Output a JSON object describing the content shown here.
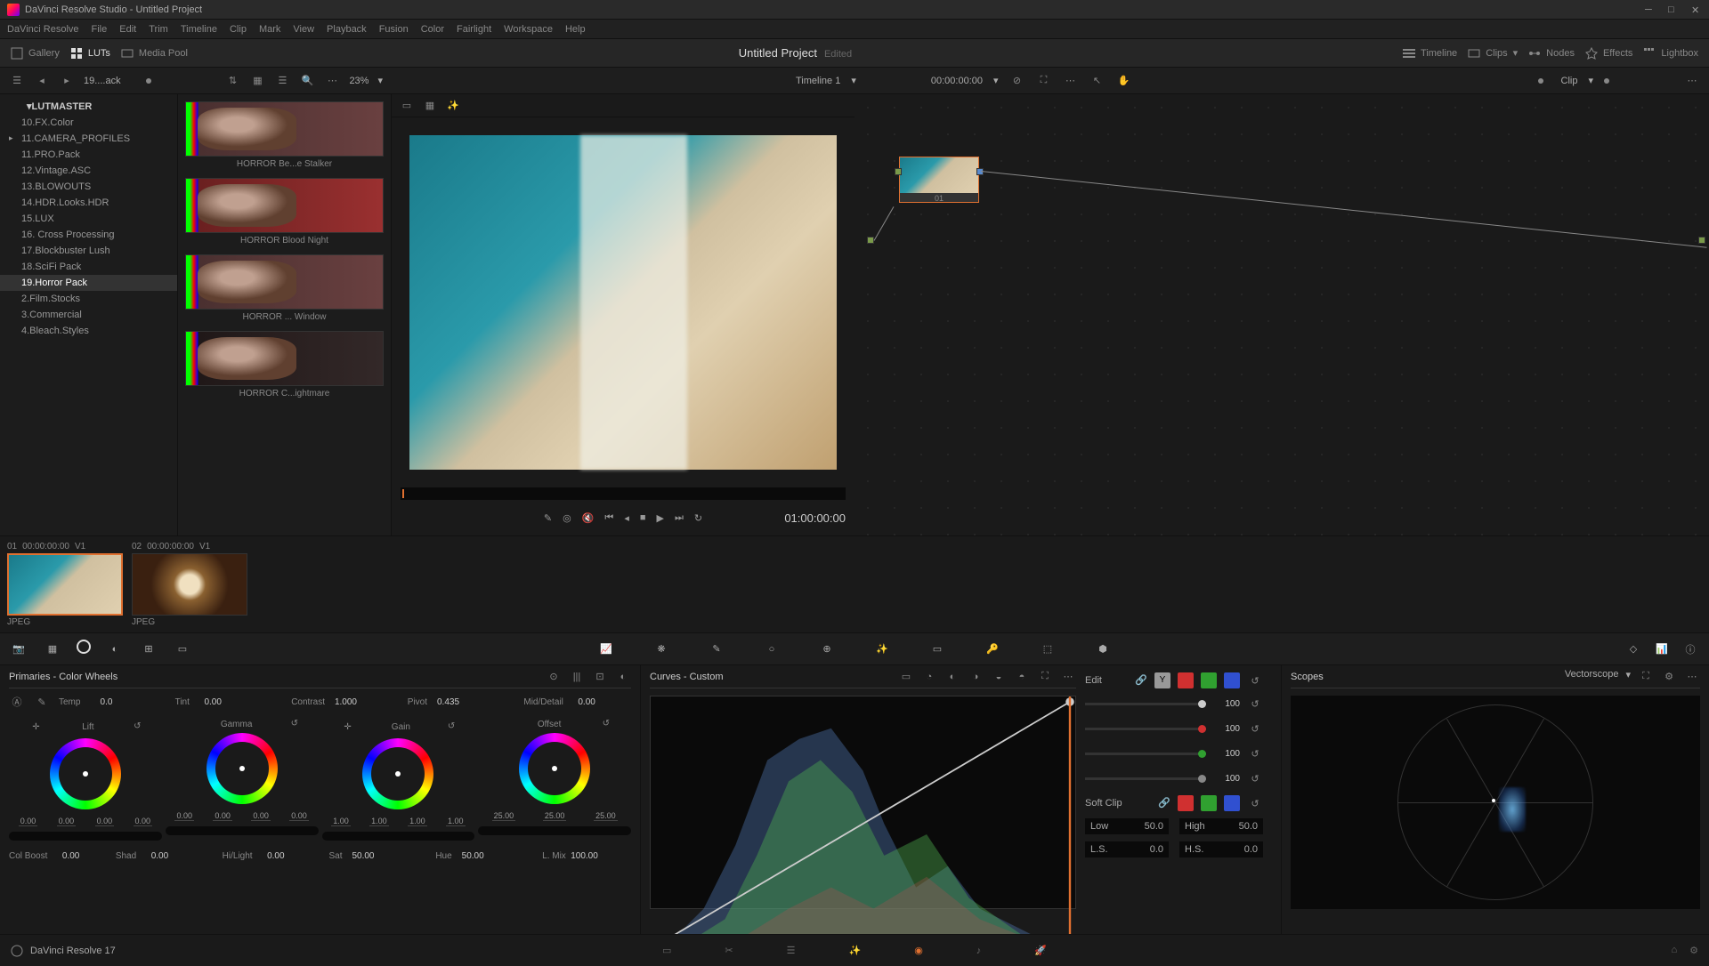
{
  "titlebar": {
    "title": "DaVinci Resolve Studio - Untitled Project"
  },
  "menu": [
    "DaVinci Resolve",
    "File",
    "Edit",
    "Trim",
    "Timeline",
    "Clip",
    "Mark",
    "View",
    "Playback",
    "Fusion",
    "Color",
    "Fairlight",
    "Workspace",
    "Help"
  ],
  "toolbar": {
    "gallery": "Gallery",
    "luts": "LUTs",
    "mediapool": "Media Pool",
    "project": "Untitled Project",
    "edited": "Edited",
    "timeline": "Timeline",
    "clips": "Clips",
    "nodes": "Nodes",
    "effects": "Effects",
    "lightbox": "Lightbox"
  },
  "secbar": {
    "path": "19....ack",
    "zoom": "23%",
    "timeline": "Timeline 1",
    "tc": "00:00:00:00",
    "clip": "Clip"
  },
  "sidebar": {
    "root": "LUTMASTER",
    "items": [
      {
        "label": "10.FX.Color"
      },
      {
        "label": "11.CAMERA_PROFILES",
        "parent": true
      },
      {
        "label": "11.PRO.Pack"
      },
      {
        "label": "12.Vintage.ASC"
      },
      {
        "label": "13.BLOWOUTS"
      },
      {
        "label": "14.HDR.Looks.HDR"
      },
      {
        "label": "15.LUX"
      },
      {
        "label": "16. Cross Processing"
      },
      {
        "label": "17.Blockbuster Lush"
      },
      {
        "label": "18.SciFi Pack"
      },
      {
        "label": "19.Horror Pack",
        "selected": true
      },
      {
        "label": "2.Film.Stocks"
      },
      {
        "label": "3.Commercial"
      },
      {
        "label": "4.Bleach.Styles"
      }
    ]
  },
  "lut_thumbs": [
    {
      "name": "HORROR Be...e Stalker",
      "cls": ""
    },
    {
      "name": "HORROR Blood Night",
      "cls": "red"
    },
    {
      "name": "HORROR ... Window",
      "cls": ""
    },
    {
      "name": "HORROR C...ightmare",
      "cls": "dark"
    }
  ],
  "viewer": {
    "tc": "01:00:00:00"
  },
  "node": {
    "label": "01"
  },
  "clips": [
    {
      "num": "01",
      "tc": "00:00:00:00",
      "track": "V1",
      "format": "JPEG",
      "cls": "beach",
      "selected": true
    },
    {
      "num": "02",
      "tc": "00:00:00:00",
      "track": "V1",
      "format": "JPEG",
      "cls": "coffee"
    }
  ],
  "primaries": {
    "title": "Primaries - Color Wheels",
    "temp": {
      "label": "Temp",
      "val": "0.0"
    },
    "tint": {
      "label": "Tint",
      "val": "0.00"
    },
    "contrast": {
      "label": "Contrast",
      "val": "1.000"
    },
    "pivot": {
      "label": "Pivot",
      "val": "0.435"
    },
    "middetail": {
      "label": "Mid/Detail",
      "val": "0.00"
    },
    "wheels": [
      {
        "name": "Lift",
        "vals": [
          "0.00",
          "0.00",
          "0.00",
          "0.00"
        ]
      },
      {
        "name": "Gamma",
        "vals": [
          "0.00",
          "0.00",
          "0.00",
          "0.00"
        ]
      },
      {
        "name": "Gain",
        "vals": [
          "1.00",
          "1.00",
          "1.00",
          "1.00"
        ]
      },
      {
        "name": "Offset",
        "vals": [
          "25.00",
          "25.00",
          "25.00"
        ]
      }
    ],
    "row2": [
      {
        "label": "Col Boost",
        "val": "0.00"
      },
      {
        "label": "Shad",
        "val": "0.00"
      },
      {
        "label": "Hi/Light",
        "val": "0.00"
      },
      {
        "label": "Sat",
        "val": "50.00"
      },
      {
        "label": "Hue",
        "val": "50.00"
      },
      {
        "label": "L. Mix",
        "val": "100.00"
      }
    ]
  },
  "curves": {
    "title": "Curves - Custom",
    "edit": "Edit",
    "channels": [
      {
        "color": "#ccc",
        "val": "100"
      },
      {
        "color": "#d03030",
        "val": "100"
      },
      {
        "color": "#30a030",
        "val": "100"
      },
      {
        "color": "#888",
        "val": "100"
      }
    ],
    "softclip": "Soft Clip",
    "low": {
      "label": "Low",
      "val": "50.0"
    },
    "high": {
      "label": "High",
      "val": "50.0"
    },
    "ls": {
      "label": "L.S.",
      "val": "0.0"
    },
    "hs": {
      "label": "H.S.",
      "val": "0.0"
    }
  },
  "scopes": {
    "title": "Scopes",
    "type": "Vectorscope"
  },
  "footer": {
    "version": "DaVinci Resolve 17"
  }
}
